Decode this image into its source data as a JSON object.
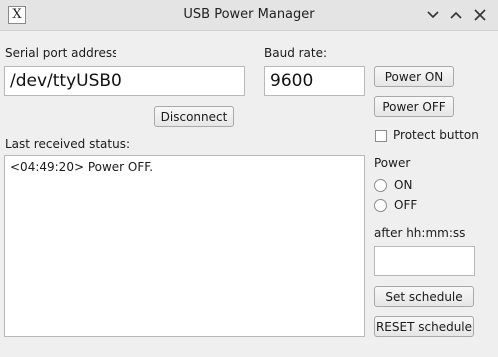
{
  "window": {
    "title": "USB Power Manager",
    "app_icon_glyph": "X"
  },
  "serial": {
    "label": "Serial port address",
    "value": "/dev/ttyUSB0"
  },
  "baud": {
    "label": "Baud rate:",
    "value": "9600"
  },
  "buttons": {
    "power_on": "Power ON",
    "power_off": "Power OFF",
    "disconnect": "Disconnect",
    "set_schedule": "Set schedule",
    "reset_schedule": "RESET schedule"
  },
  "protect": {
    "label": "Protect button",
    "checked": false
  },
  "status": {
    "label": "Last received status:",
    "text": "<04:49:20> Power OFF."
  },
  "power_group": {
    "label": "Power",
    "options": [
      "ON",
      "OFF"
    ]
  },
  "schedule": {
    "label": "after hh:mm:ss",
    "value": ""
  }
}
